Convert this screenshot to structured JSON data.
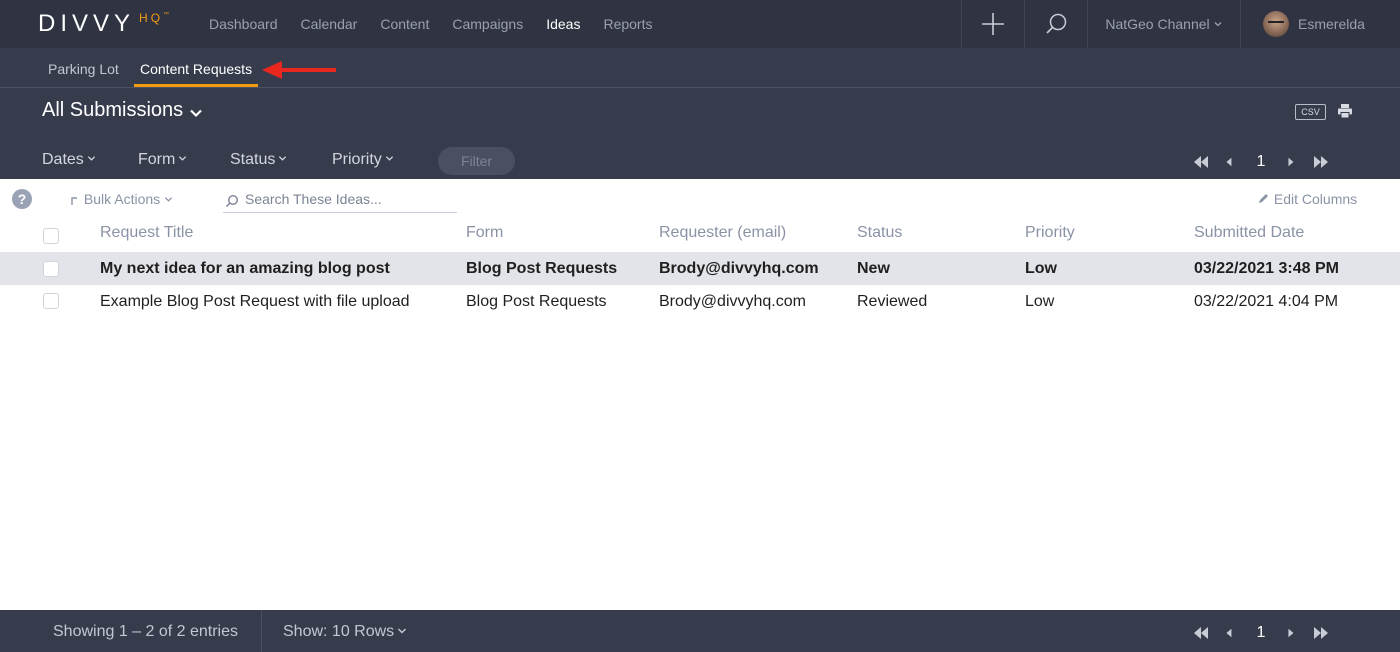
{
  "app": {
    "logo_main": "DIVVY",
    "logo_hq": "HQ",
    "logo_tm": "™"
  },
  "nav": {
    "items": [
      {
        "label": "Dashboard",
        "active": false
      },
      {
        "label": "Calendar",
        "active": false
      },
      {
        "label": "Content",
        "active": false
      },
      {
        "label": "Campaigns",
        "active": false
      },
      {
        "label": "Ideas",
        "active": true
      },
      {
        "label": "Reports",
        "active": false
      }
    ],
    "channel": "NatGeo Channel",
    "user": "Esmerelda"
  },
  "subnav": {
    "tabs": [
      {
        "label": "Parking Lot",
        "active": false
      },
      {
        "label": "Content Requests",
        "active": true
      }
    ]
  },
  "header": {
    "title": "All Submissions",
    "csv_label": "CSV",
    "filters": [
      "Dates",
      "Form",
      "Status",
      "Priority"
    ],
    "filter_button": "Filter",
    "page": "1"
  },
  "toolbar": {
    "bulk_actions": "Bulk Actions",
    "search_placeholder": "Search These Ideas...",
    "edit_columns": "Edit Columns"
  },
  "table": {
    "columns": [
      "Request Title",
      "Form",
      "Requester (email)",
      "Status",
      "Priority",
      "Submitted Date"
    ],
    "rows": [
      {
        "title": "My next idea for an amazing blog post",
        "form": "Blog Post Requests",
        "requester": "Brody@divvyhq.com",
        "status": "New",
        "priority": "Low",
        "date": "03/22/2021 3:48 PM"
      },
      {
        "title": "Example Blog Post Request with file upload",
        "form": "Blog Post Requests",
        "requester": "Brody@divvyhq.com",
        "status": "Reviewed",
        "priority": "Low",
        "date": "03/22/2021 4:04 PM"
      }
    ]
  },
  "footer": {
    "showing": "Showing 1 – 2 of 2 entries",
    "rows_label": "Show: 10 Rows",
    "page": "1"
  },
  "colors": {
    "nav_bg": "#2f3342",
    "panel_bg": "#373c4d",
    "accent": "#f39c12",
    "annotation_arrow": "#e8281f",
    "row_highlight": "#e2e4ea"
  }
}
